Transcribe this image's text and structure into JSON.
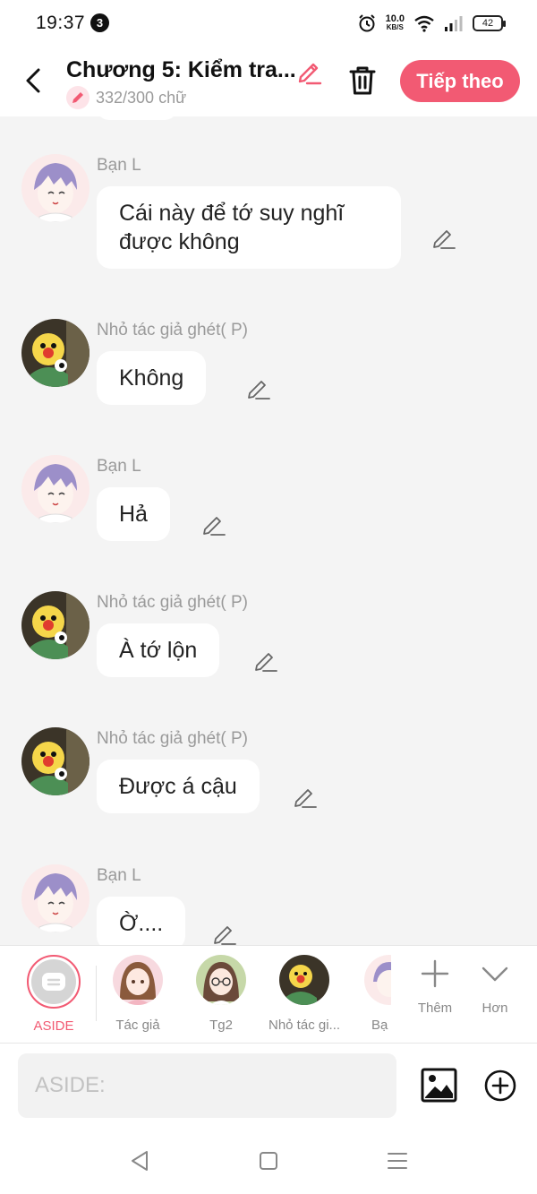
{
  "status_bar": {
    "time": "19:37",
    "notification_count": "3",
    "net_speed": "10.0",
    "net_speed_unit": "KB/S",
    "battery": "42"
  },
  "header": {
    "title": "Chương 5: Kiểm tra...",
    "word_count": "332/300 chữ",
    "next_label": "Tiếp theo",
    "accent_color": "#f25a73"
  },
  "messages": [
    {
      "sender": "Bạn L",
      "text_lines": [
        "Cái này để tớ suy nghĩ",
        "được không"
      ],
      "avatar": "lavender-hair-character"
    },
    {
      "sender": "Nhỏ tác giả ghét( P)",
      "text_lines": [
        "Không"
      ],
      "avatar": "clown-character"
    },
    {
      "sender": "Bạn L",
      "text_lines": [
        "Hả"
      ],
      "avatar": "lavender-hair-character"
    },
    {
      "sender": "Nhỏ tác giả ghét( P)",
      "text_lines": [
        "À tớ lộn"
      ],
      "avatar": "clown-character"
    },
    {
      "sender": "Nhỏ tác giả ghét( P)",
      "text_lines": [
        "Được á cậu"
      ],
      "avatar": "clown-character"
    },
    {
      "sender": "Bạn L",
      "text_lines": [
        "Ờ...."
      ],
      "avatar": "lavender-hair-character"
    }
  ],
  "character_bar": {
    "aside_label": "ASIDE",
    "characters": [
      {
        "label": "Tác giả",
        "avatar": "brown-hair-girl"
      },
      {
        "label": "Tg2",
        "avatar": "glasses-girl"
      },
      {
        "label": "Nhỏ tác gi...",
        "avatar": "clown-character"
      },
      {
        "label": "Bạ",
        "avatar": "lavender-hair-character"
      }
    ],
    "more_label": "Thêm",
    "expand_label": "Hơn"
  },
  "input": {
    "placeholder": "ASIDE:"
  },
  "nav": {
    "back": "back-triangle",
    "home": "home-square",
    "menu": "menu-lines"
  }
}
